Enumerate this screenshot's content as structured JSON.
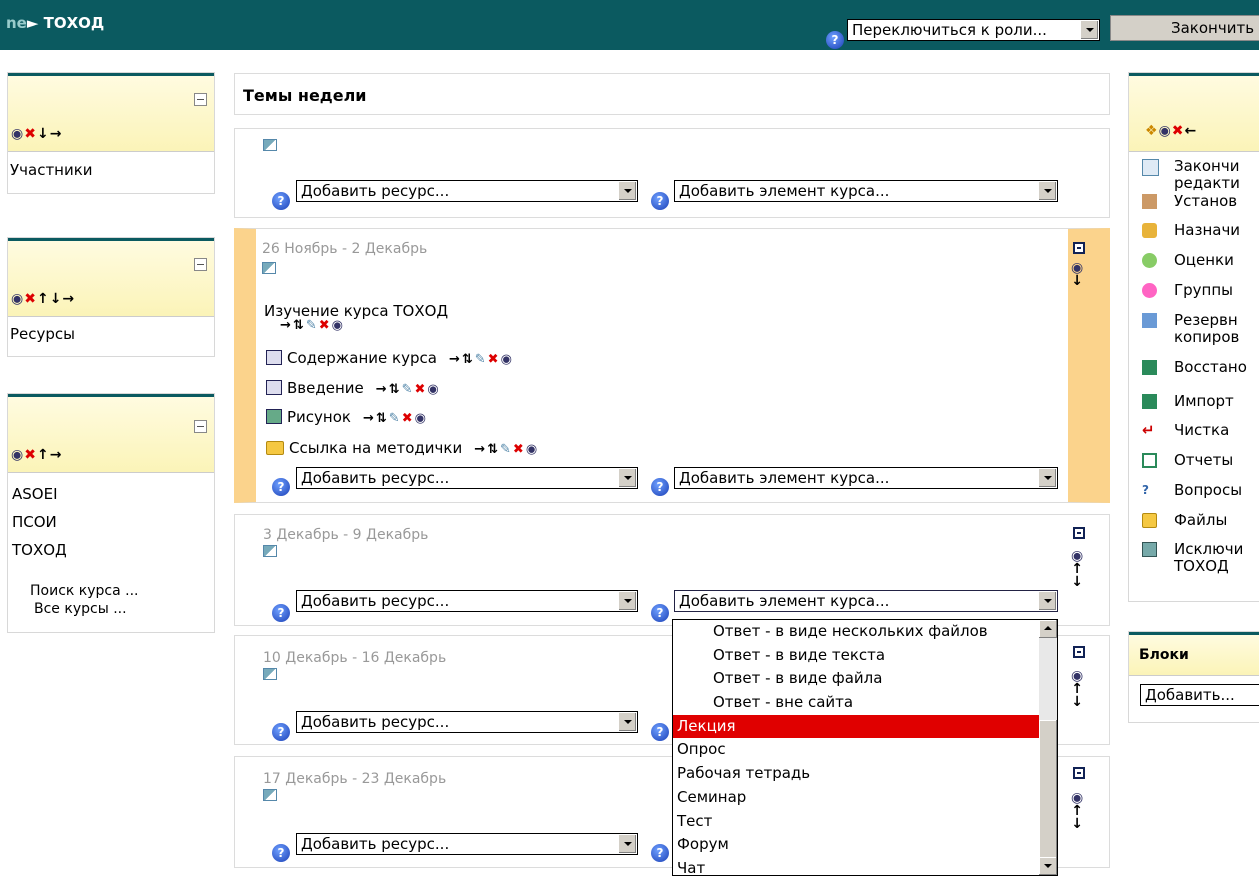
{
  "header": {
    "breadcrumb_prefix": "ne",
    "breadcrumb": "ТОХОД",
    "role_switch": "Переключиться к роли...",
    "finish_button": "Закончить"
  },
  "left_blocks": {
    "participants": {
      "items": [
        "Участники"
      ]
    },
    "resources": {
      "items": [
        "Ресурсы"
      ]
    },
    "courses": {
      "items": [
        "ASOEI",
        "ПСОИ",
        "ТОХОД"
      ],
      "search": "Поиск курса ...",
      "all": "Все курсы ..."
    }
  },
  "main": {
    "title": "Темы недели",
    "add_resource": "Добавить ресурс...",
    "add_activity": "Добавить элемент курса...",
    "sections": [
      {
        "date": ""
      },
      {
        "date": "26 Ноябрь - 2 Декабрь",
        "heading": "Изучение курса ТОХОД",
        "items": [
          "Содержание курса",
          "Введение",
          "Рисунок",
          "Ссылка на методички"
        ]
      },
      {
        "date": "3 Декабрь - 9 Декабрь"
      },
      {
        "date": "10 Декабрь - 16 Декабрь"
      },
      {
        "date": "17 Декабрь - 23 Декабрь"
      }
    ]
  },
  "dropdown_options": [
    "Ответ - в виде нескольких файлов",
    "Ответ - в виде текста",
    "Ответ - в виде файла",
    "Ответ - вне сайта",
    "Лекция",
    "Опрос",
    "Рабочая тетрадь",
    "Семинар",
    "Тест",
    "Форум",
    "Чат"
  ],
  "dropdown_highlighted": "Лекция",
  "admin": {
    "items": [
      "Закончи",
      "редакти",
      "Установ",
      "Назначи",
      "Оценки",
      "Группы",
      "Резервн",
      "копиров",
      "Восстано",
      "Импорт",
      "Чистка",
      "Отчеты",
      "Вопросы",
      "Файлы",
      "Исключи",
      "ТОХОД"
    ]
  },
  "blocks_block": {
    "title": "Блоки",
    "add": "Добавить..."
  },
  "colors": {
    "header_bg": "#0b5a60",
    "highlight": "#e00000",
    "current_section": "#fbd38c"
  }
}
